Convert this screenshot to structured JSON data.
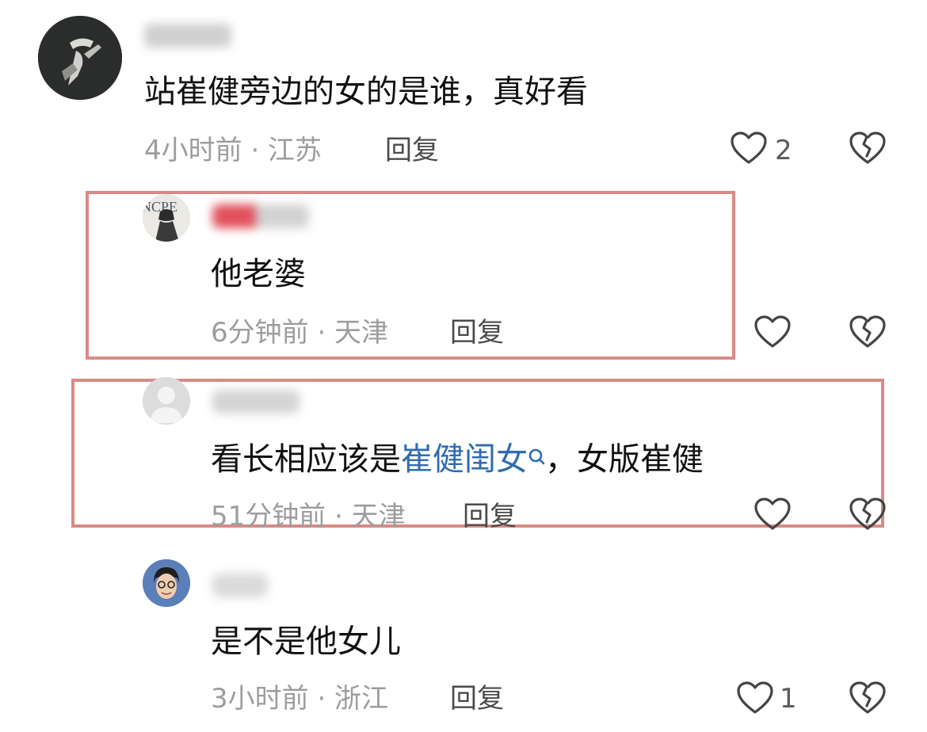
{
  "comments": [
    {
      "text": "站崔健旁边的女的是谁，真好看",
      "meta": "4小时前 · 江苏",
      "reply": "回复",
      "likes": "2"
    },
    {
      "text": "他老婆",
      "meta": "6分钟前 · 天津",
      "reply": "回复",
      "likes": ""
    },
    {
      "text_before": "看长相应该是",
      "link": "崔健闺女",
      "text_after": "，女版崔健",
      "meta": "51分钟前 · 天津",
      "reply": "回复",
      "likes": ""
    },
    {
      "text": "是不是他女儿",
      "meta": "3小时前 · 浙江",
      "reply": "回复",
      "likes": "1"
    }
  ],
  "icons": {
    "like": "heart-outline-icon",
    "dislike": "broken-heart-icon",
    "search": "search-icon"
  },
  "colors": {
    "highlight": "#d98a86",
    "link": "#2f6bb0",
    "meta": "#9d9d9d"
  }
}
